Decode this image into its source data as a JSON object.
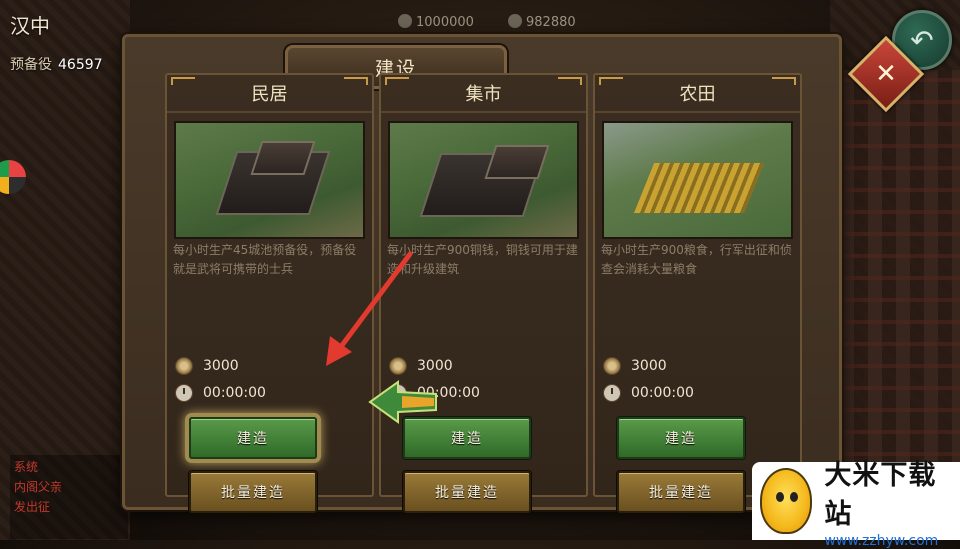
{
  "hud": {
    "city_name": "汉中",
    "reserve_label": "预备役",
    "reserve_value": "46597",
    "copper": "1000000",
    "grain": "982880"
  },
  "chat": {
    "lines": [
      "系统",
      "内阁父亲",
      "发出征"
    ]
  },
  "panel": {
    "title": "建设",
    "close_icon": "close-x-icon"
  },
  "buildings": [
    {
      "name": "民居",
      "description": "每小时生产45城池预备役，预备役就是武将可携带的士兵",
      "cost": "3000",
      "time": "00:00:00",
      "build_label": "建造",
      "batch_label": "批量建造"
    },
    {
      "name": "集市",
      "description": "每小时生产900铜钱，铜钱可用于建造和升级建筑",
      "cost": "3000",
      "time": "00:00:00",
      "build_label": "建造",
      "batch_label": "批量建造"
    },
    {
      "name": "农田",
      "description": "每小时生产900粮食，行军出征和侦查会消耗大量粮食",
      "cost": "3000",
      "time": "00:00:00",
      "build_label": "建造",
      "batch_label": "批量建造"
    }
  ],
  "watermark": {
    "title": "大米下载站",
    "url": "www.zzhyw.com"
  },
  "colors": {
    "build_green": "#3f7f34",
    "batch_gold": "#8a6a2c",
    "close_red": "#b23a2e",
    "arrow_red": "#e23a2e"
  }
}
